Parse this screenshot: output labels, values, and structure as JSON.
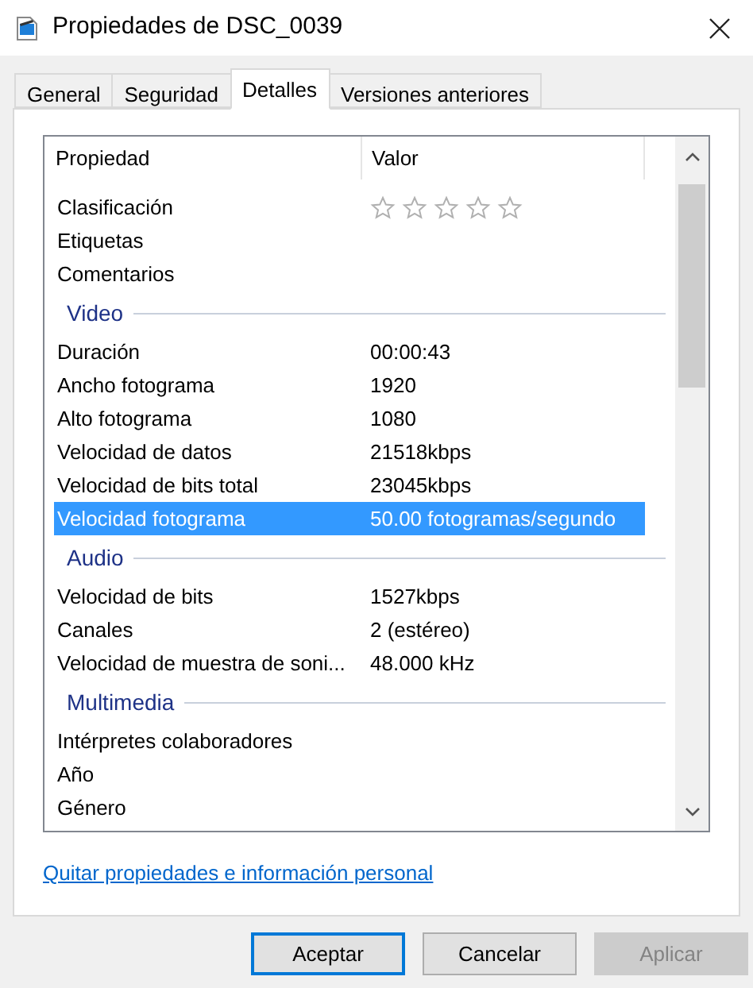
{
  "window": {
    "title": "Propiedades de DSC_0039"
  },
  "tabs": [
    {
      "label": "General",
      "selected": false
    },
    {
      "label": "Seguridad",
      "selected": false
    },
    {
      "label": "Detalles",
      "selected": true
    },
    {
      "label": "Versiones anteriores",
      "selected": false
    }
  ],
  "table": {
    "columns": [
      "Propiedad",
      "Valor"
    ],
    "rows": [
      {
        "kind": "rating",
        "name": "Clasificación",
        "stars": 0,
        "selected": false
      },
      {
        "kind": "row",
        "name": "Etiquetas",
        "selected": false
      },
      {
        "kind": "row",
        "name": "Comentarios",
        "selected": false
      },
      {
        "kind": "group",
        "name": "Video"
      },
      {
        "kind": "row",
        "name": "Duración",
        "value": "00:00:43",
        "selected": false
      },
      {
        "kind": "row",
        "name": "Ancho fotograma",
        "value": "1920",
        "selected": false
      },
      {
        "kind": "row",
        "name": "Alto fotograma",
        "value": "1080",
        "selected": false
      },
      {
        "kind": "row",
        "name": "Velocidad de datos",
        "value": "21518kbps",
        "selected": false
      },
      {
        "kind": "row",
        "name": "Velocidad de bits total",
        "value": "23045kbps",
        "selected": false
      },
      {
        "kind": "row",
        "name": "Velocidad fotograma",
        "value": "50.00 fotogramas/segundo",
        "selected": true
      },
      {
        "kind": "group",
        "name": "Audio"
      },
      {
        "kind": "row",
        "name": "Velocidad de bits",
        "value": "1527kbps",
        "selected": false
      },
      {
        "kind": "row",
        "name": "Canales",
        "value": "2 (estéreo)",
        "selected": false
      },
      {
        "kind": "row",
        "name": "Velocidad de muestra de soni...",
        "value": "48.000 kHz",
        "selected": false
      },
      {
        "kind": "group",
        "name": "Multimedia"
      },
      {
        "kind": "row",
        "name": "Intérpretes colaboradores",
        "selected": false
      },
      {
        "kind": "row",
        "name": "Año",
        "selected": false
      },
      {
        "kind": "row",
        "name": "Género",
        "selected": false
      }
    ]
  },
  "link": "Quitar propiedades e información personal",
  "buttons": [
    {
      "label": "Aceptar",
      "disabled": false,
      "default": true
    },
    {
      "label": "Cancelar",
      "disabled": false,
      "default": false
    },
    {
      "label": "Aplicar",
      "disabled": true,
      "default": false
    }
  ]
}
